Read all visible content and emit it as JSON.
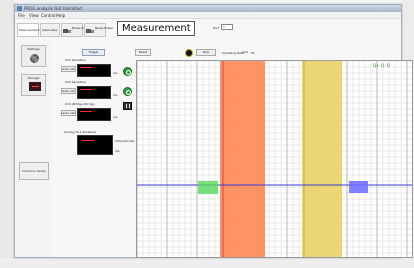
{
  "window": {
    "title": "PROG analysis GUI Unlimited"
  },
  "menu": [
    "File",
    "View",
    "Control",
    "Help"
  ],
  "tabs": [
    {
      "label": "Measurement"
    },
    {
      "label": "Alternates"
    },
    {
      "label": "Noise Power"
    },
    {
      "label": "Noise Power"
    }
  ],
  "header": {
    "title": "Measurement",
    "port_label": "Port",
    "port_value": "1"
  },
  "sidebar": {
    "settings_label": "Settings",
    "storage_label": "Storage",
    "common_setup_label": "Common Setup"
  },
  "panel": {
    "trigger_label": "Trigger",
    "rows": [
      {
        "title": "Ch1 Sensitive",
        "reset_label": "auto set",
        "unit": "ms"
      },
      {
        "title": "Ch2 Sensitive",
        "reset_label": "auto set",
        "unit": "ms"
      },
      {
        "title": "Ch3 (Bridge Wiring)",
        "reset_label": "auto set",
        "unit": "ms"
      },
      {
        "title": "Analog Ch1 Sensitive",
        "reset_label": "",
        "unit": "mV(optional)"
      }
    ],
    "last_unit2": "ms"
  },
  "plot_header": {
    "reset_label": "Reset",
    "stop_label": "Stop",
    "sampling_label": "Sampling Rate",
    "sampling_value": "1k/s",
    "sampling_unit": "Hz"
  },
  "plot": {
    "zoom_icons": "Q+ Q- Q",
    "colors": {
      "grid": "#c9c9c9",
      "grid_major": "#9a9a9a",
      "baseline": "#3a3acf",
      "band1": "#ff8a55",
      "band1_edge": "#e33c3c",
      "band2": "#ead066",
      "band2_edge": "#c8a51c",
      "marker_green": "#57d957",
      "marker_blue": "#6b6bff"
    }
  }
}
